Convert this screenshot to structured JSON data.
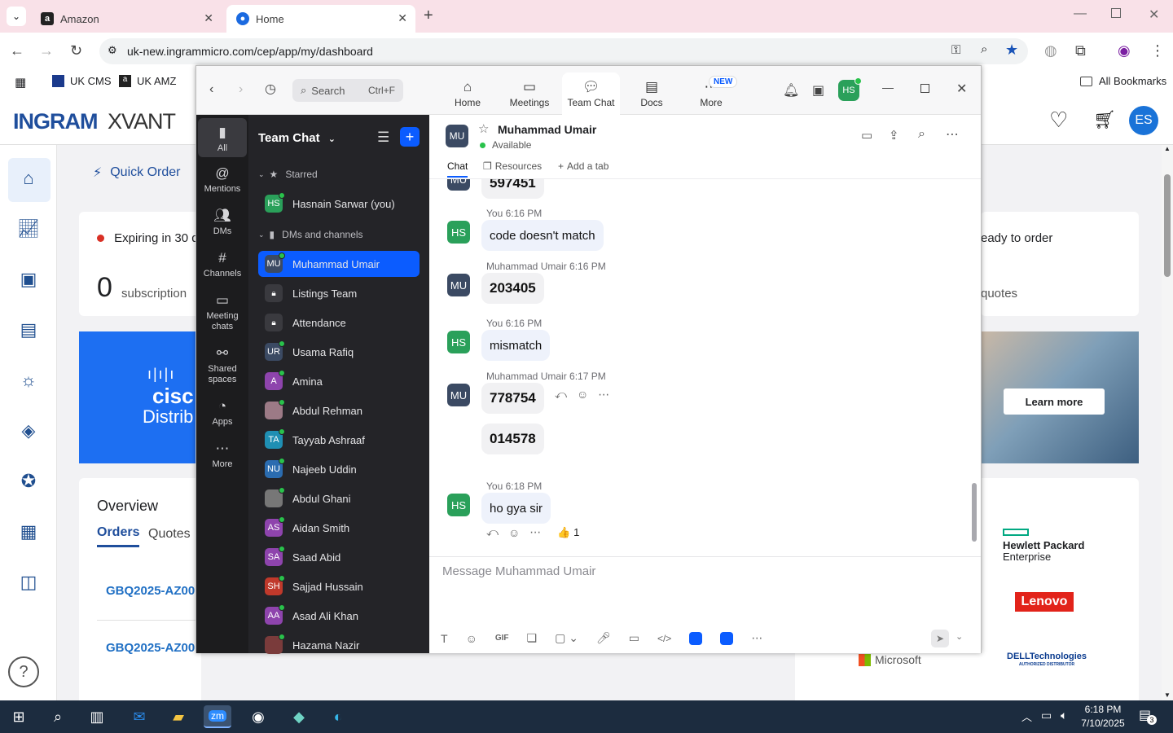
{
  "browser": {
    "tabs": [
      {
        "title": "Amazon",
        "favicon": "a"
      },
      {
        "title": "Home",
        "favicon": "zoom"
      }
    ],
    "url": "uk-new.ingrammicro.com/cep/app/my/dashboard",
    "bookmarks": [
      "UK CMS",
      "UK AMZ"
    ],
    "all_bookmarks": "All Bookmarks"
  },
  "ingram": {
    "logo": "INGRAM",
    "logo_sub": "XVANT",
    "quick_order": "Quick Order",
    "expiring": "Expiring in 30 d",
    "expiring_count": "0",
    "subscriptions": "subscription",
    "ready": "eady to order",
    "quotes_word": "quotes",
    "promo_brand": "cisc",
    "promo_sub": "Distrib",
    "learn_more": "Learn more",
    "overview": "Overview",
    "tab_orders": "Orders",
    "tab_quotes": "Quotes",
    "order_rows": [
      "GBQ2025-AZ00",
      "GBQ2025-AZ00"
    ],
    "avatar_initials": "ES",
    "vendors": [
      "Hewlett Packard",
      "Enterprise",
      "Lenovo",
      "Microsoft",
      "DELLTechnologies",
      "AUTHORIZED DISTRIBUTOR"
    ]
  },
  "zoom": {
    "search_placeholder": "Search",
    "search_shortcut": "Ctrl+F",
    "nav": [
      {
        "label": "Home",
        "icon": "home-icon"
      },
      {
        "label": "Meetings",
        "icon": "video-icon"
      },
      {
        "label": "Team Chat",
        "icon": "chat-icon"
      },
      {
        "label": "Docs",
        "icon": "doc-icon"
      },
      {
        "label": "More",
        "icon": "more-icon"
      }
    ],
    "new_badge": "NEW",
    "user_initials": "HS",
    "rail": [
      {
        "label": "All"
      },
      {
        "label": "Mentions"
      },
      {
        "label": "DMs"
      },
      {
        "label": "Channels"
      },
      {
        "label": "Meeting chats"
      },
      {
        "label": "Shared spaces"
      },
      {
        "label": "Apps"
      },
      {
        "label": "More"
      }
    ],
    "list_title": "Team Chat",
    "starred_header": "Starred",
    "starred": [
      {
        "initials": "HS",
        "name": "Hasnain Sarwar (you)",
        "color": "#2aa05a"
      }
    ],
    "dms_header": "DMs and channels",
    "dms": [
      {
        "initials": "MU",
        "name": "Muhammad Umair",
        "color": "#3b4a63",
        "selected": true
      },
      {
        "initials": "",
        "name": "Listings Team",
        "color": "#3a3a3f",
        "lock": true
      },
      {
        "initials": "",
        "name": "Attendance",
        "color": "#3a3a3f",
        "lock": true
      },
      {
        "initials": "UR",
        "name": "Usama Rafiq",
        "color": "#3b4a63"
      },
      {
        "initials": "A",
        "name": "Amina",
        "color": "#8e44ad"
      },
      {
        "initials": "",
        "name": "Abdul Rehman",
        "color": "#9c7a86"
      },
      {
        "initials": "TA",
        "name": "Tayyab Ashraaf",
        "color": "#1f8fb3"
      },
      {
        "initials": "NU",
        "name": "Najeeb Uddin",
        "color": "#2b6cb0"
      },
      {
        "initials": "",
        "name": "Abdul Ghani",
        "color": "#777"
      },
      {
        "initials": "AS",
        "name": "Aidan Smith",
        "color": "#8e44ad"
      },
      {
        "initials": "SA",
        "name": "Saad Abid",
        "color": "#8e44ad"
      },
      {
        "initials": "SH",
        "name": "Sajjad Hussain",
        "color": "#c0392b"
      },
      {
        "initials": "AA",
        "name": "Asad Ali Khan",
        "color": "#8e44ad"
      },
      {
        "initials": "",
        "name": "Hazama Nazir",
        "color": "#7a3b3b"
      }
    ],
    "chat": {
      "contact_initials": "MU",
      "contact_name": "Muhammad Umair",
      "status": "Available",
      "tabs": [
        "Chat",
        "Resources",
        "Add a tab"
      ],
      "messages": [
        {
          "sender_initials": "MU",
          "meta": "",
          "text": "597451",
          "bold": true
        },
        {
          "sender_initials": "HS",
          "meta": "You 6:16 PM",
          "text": "code doesn't match",
          "bold": false
        },
        {
          "sender_initials": "MU",
          "meta": "Muhammad Umair 6:16 PM",
          "text": "203405",
          "bold": true
        },
        {
          "sender_initials": "HS",
          "meta": "You 6:16 PM",
          "text": "mismatch",
          "bold": false
        },
        {
          "sender_initials": "MU",
          "meta": "Muhammad Umair 6:17 PM",
          "text": "778754",
          "bold": true
        },
        {
          "sender_initials": "",
          "meta": "",
          "text": "014578",
          "bold": true
        },
        {
          "sender_initials": "HS",
          "meta": "You 6:18 PM",
          "text": "ho gya sir",
          "bold": false
        }
      ],
      "reaction": "👍",
      "reaction_count": "1",
      "composer_placeholder": "Message Muhammad Umair"
    }
  },
  "taskbar": {
    "time": "6:18 PM",
    "date": "7/10/2025",
    "notif_count": "3"
  }
}
